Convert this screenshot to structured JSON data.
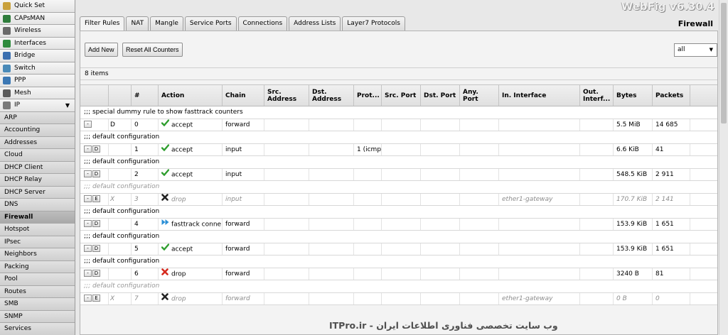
{
  "app": {
    "brand": "WebFig v6.30.4",
    "section_title": "Firewall"
  },
  "sidebar": {
    "top_items": [
      {
        "label": "Quick Set",
        "icon": "quick-set-icon",
        "color": "#c9a13c"
      },
      {
        "label": "CAPsMAN",
        "icon": "capsman-icon",
        "color": "#2f7d3c"
      },
      {
        "label": "Wireless",
        "icon": "wireless-icon",
        "color": "#6a6a6a"
      },
      {
        "label": "Interfaces",
        "icon": "interfaces-icon",
        "color": "#2e8b3d"
      },
      {
        "label": "Bridge",
        "icon": "bridge-icon",
        "color": "#3b6fb0"
      },
      {
        "label": "Switch",
        "icon": "switch-icon",
        "color": "#4a8ab8"
      },
      {
        "label": "PPP",
        "icon": "ppp-icon",
        "color": "#3c78b4"
      },
      {
        "label": "Mesh",
        "icon": "mesh-icon",
        "color": "#5c5c5c"
      },
      {
        "label": "IP",
        "icon": "ip-icon",
        "color": "#7a7a7a",
        "caret": "▼"
      }
    ],
    "sub_items": [
      "ARP",
      "Accounting",
      "Addresses",
      "Cloud",
      "DHCP Client",
      "DHCP Relay",
      "DHCP Server",
      "DNS",
      "Firewall",
      "Hotspot",
      "IPsec",
      "Neighbors",
      "Packing",
      "Pool",
      "Routes",
      "SMB",
      "SNMP",
      "Services"
    ],
    "active_sub": "Firewall"
  },
  "tabs": [
    "Filter Rules",
    "NAT",
    "Mangle",
    "Service Ports",
    "Connections",
    "Address Lists",
    "Layer7 Protocols"
  ],
  "active_tab": "Filter Rules",
  "toolbar": {
    "add_new": "Add New",
    "reset_counters": "Reset All Counters",
    "filter_value": "all",
    "filter_arrow": "▼"
  },
  "items_count": "8 items",
  "columns": [
    {
      "key": "ctl",
      "label": ""
    },
    {
      "key": "flag",
      "label": ""
    },
    {
      "key": "num",
      "label": "#"
    },
    {
      "key": "action",
      "label": "Action"
    },
    {
      "key": "chain",
      "label": "Chain"
    },
    {
      "key": "src",
      "label": "Src. Address"
    },
    {
      "key": "dst",
      "label": "Dst. Address"
    },
    {
      "key": "proto",
      "label": "Prot..."
    },
    {
      "key": "sport",
      "label": "Src. Port"
    },
    {
      "key": "dport",
      "label": "Dst. Port"
    },
    {
      "key": "anyport",
      "label": "Any. Port"
    },
    {
      "key": "inif",
      "label": "In. Interface"
    },
    {
      "key": "outif",
      "label": "Out. Interf..."
    },
    {
      "key": "bytes",
      "label": "Bytes"
    },
    {
      "key": "packets",
      "label": "Packets"
    }
  ],
  "rules": [
    {
      "comment": ";;; special dummy rule to show fasttrack counters",
      "buttons": [
        "-"
      ],
      "flag": "D",
      "num": "0",
      "action": "accept",
      "action_icon": "check",
      "chain": "forward",
      "proto": "",
      "inif": "",
      "bytes": "5.5 MiB",
      "packets": "14 685",
      "disabled": false
    },
    {
      "comment": ";;; default configuration",
      "buttons": [
        "-",
        "D"
      ],
      "flag": "",
      "num": "1",
      "action": "accept",
      "action_icon": "check",
      "chain": "input",
      "proto": "1 (icmp",
      "inif": "",
      "bytes": "6.6 KiB",
      "packets": "41",
      "disabled": false
    },
    {
      "comment": ";;; default configuration",
      "buttons": [
        "-",
        "D"
      ],
      "flag": "",
      "num": "2",
      "action": "accept",
      "action_icon": "check",
      "chain": "input",
      "proto": "",
      "inif": "",
      "bytes": "548.5 KiB",
      "packets": "2 911",
      "disabled": false
    },
    {
      "comment": ";;; default configuration",
      "buttons": [
        "-",
        "E"
      ],
      "flag": "X",
      "num": "3",
      "action": "drop",
      "action_icon": "x-black",
      "chain": "input",
      "proto": "",
      "inif": "ether1-gateway",
      "bytes": "170.7 KiB",
      "packets": "2 141",
      "disabled": true
    },
    {
      "comment": ";;; default configuration",
      "buttons": [
        "-",
        "D"
      ],
      "flag": "",
      "num": "4",
      "action": "fasttrack conne",
      "action_icon": "fasttrack",
      "chain": "forward",
      "proto": "",
      "inif": "",
      "bytes": "153.9 KiB",
      "packets": "1 651",
      "disabled": false
    },
    {
      "comment": ";;; default configuration",
      "buttons": [
        "-",
        "D"
      ],
      "flag": "",
      "num": "5",
      "action": "accept",
      "action_icon": "check",
      "chain": "forward",
      "proto": "",
      "inif": "",
      "bytes": "153.9 KiB",
      "packets": "1 651",
      "disabled": false
    },
    {
      "comment": ";;; default configuration",
      "buttons": [
        "-",
        "D"
      ],
      "flag": "",
      "num": "6",
      "action": "drop",
      "action_icon": "x-red",
      "chain": "forward",
      "proto": "",
      "inif": "",
      "bytes": "3240 B",
      "packets": "81",
      "disabled": false
    },
    {
      "comment": ";;; default configuration",
      "buttons": [
        "-",
        "E"
      ],
      "flag": "X",
      "num": "7",
      "action": "drop",
      "action_icon": "x-black",
      "chain": "forward",
      "proto": "",
      "inif": "ether1-gateway",
      "bytes": "0 B",
      "packets": "0",
      "disabled": true
    }
  ],
  "watermark": "ITPro.ir - وب سایت تخصصی فناوری اطلاعات ایران",
  "colors": {
    "accept": "#2f9e2f",
    "drop_red": "#d62b1f",
    "drop_black": "#222222",
    "fasttrack": "#2b8fd6"
  }
}
